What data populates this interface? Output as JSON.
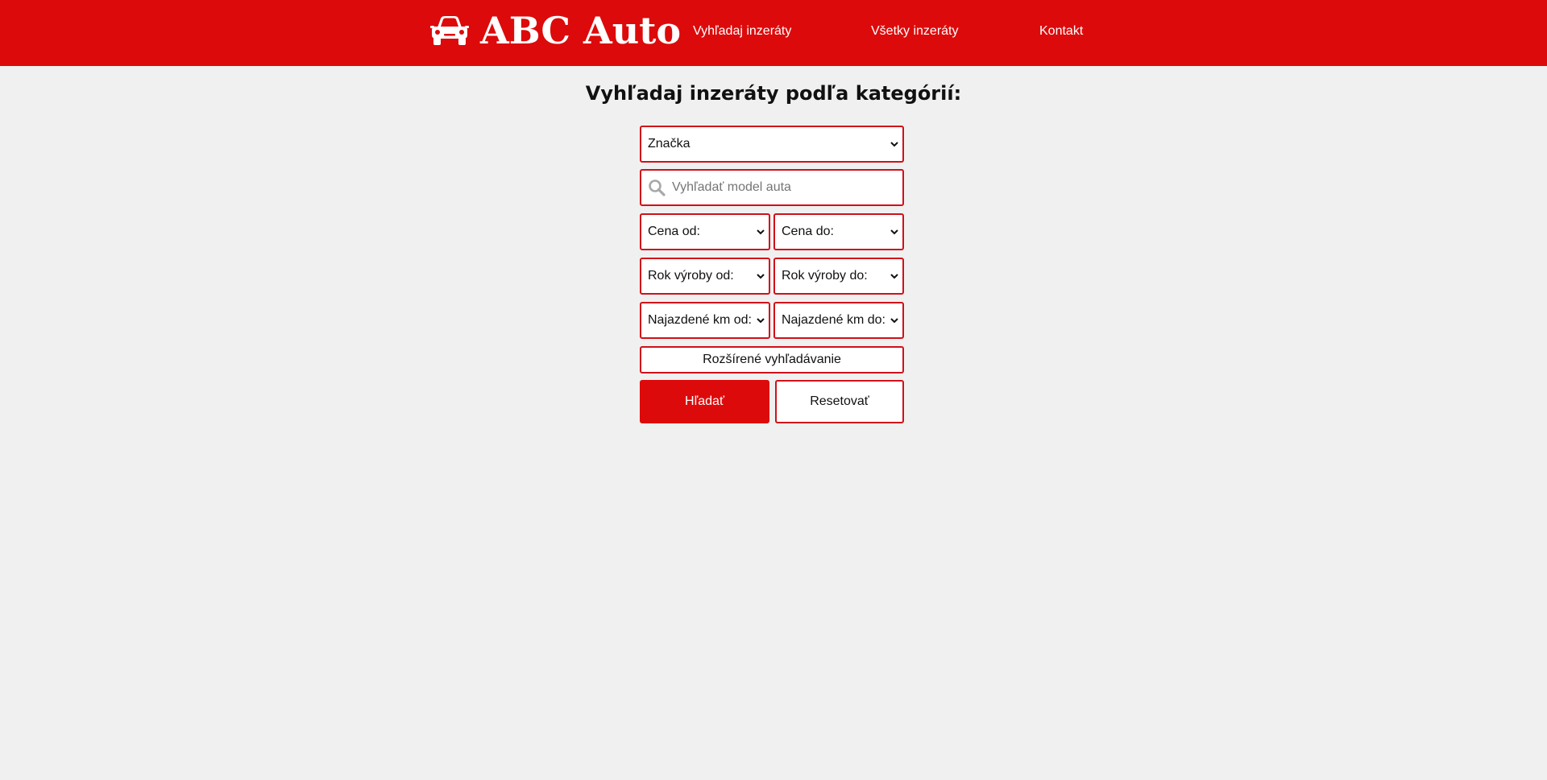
{
  "header": {
    "brand": "ABC Auto",
    "brand_icon": "car-icon",
    "nav": [
      {
        "label": "Vyhľadaj inzeráty"
      },
      {
        "label": "Všetky inzeráty"
      },
      {
        "label": "Kontakt"
      }
    ],
    "color": "#dd0a0b"
  },
  "main": {
    "title": "Vyhľadaj inzeráty podľa kategórií:"
  },
  "form": {
    "brand_select": "Značka",
    "model_search": {
      "placeholder": "Vyhľadať model auta",
      "value": "",
      "icon": "search-icon"
    },
    "price_from": "Cena od:",
    "price_to": "Cena do:",
    "year_from": "Rok výroby od:",
    "year_to": "Rok výroby do:",
    "km_from": "Najazdené km od:",
    "km_to": "Najazdené km do:",
    "advanced_label": "Rozšírené vyhľadávanie",
    "search_label": "Hľadať",
    "reset_label": "Resetovať"
  },
  "colors": {
    "accent": "#dd0a0b",
    "background": "#f0f0f0"
  }
}
